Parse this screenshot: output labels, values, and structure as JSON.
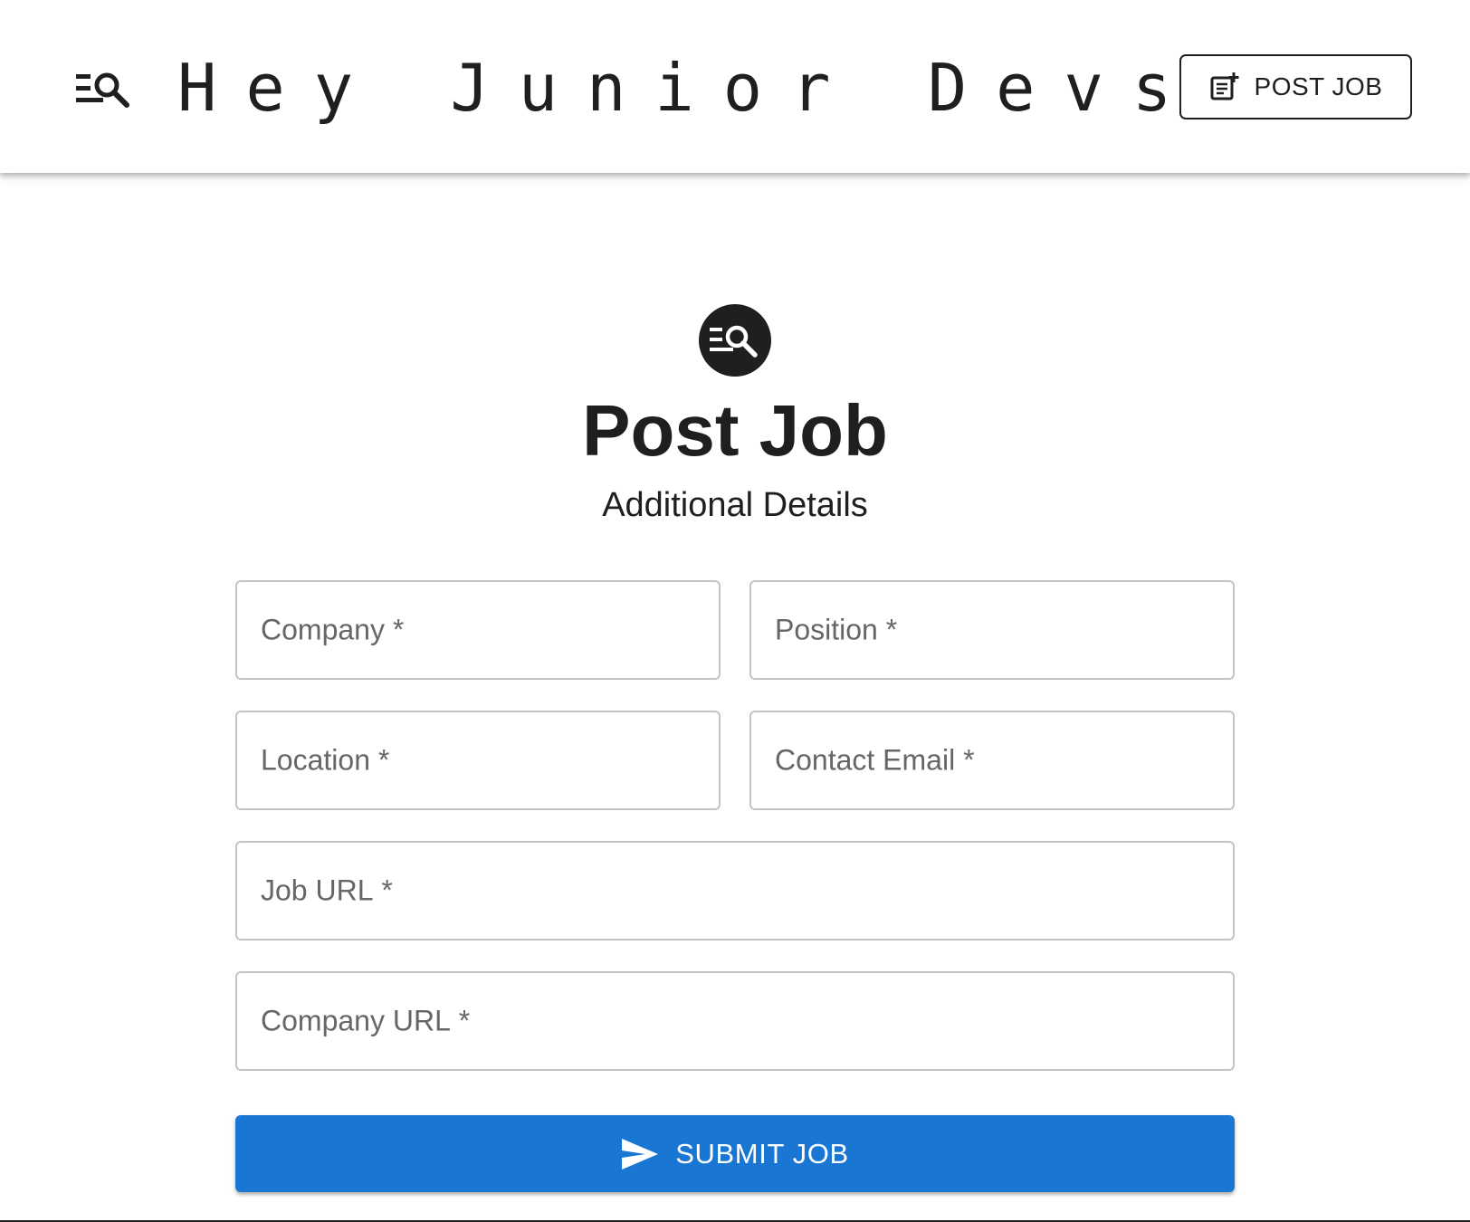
{
  "header": {
    "logo_icon": "manage-search-icon",
    "title": "Hey Junior Devs!",
    "post_job_label": "POST JOB",
    "post_job_icon": "post-add-icon"
  },
  "main": {
    "avatar_icon": "manage-search-icon",
    "title": "Post Job",
    "subtitle": "Additional Details"
  },
  "form": {
    "fields": [
      {
        "label": "Company",
        "required": "*",
        "value": ""
      },
      {
        "label": "Position",
        "required": "*",
        "value": ""
      },
      {
        "label": "Location",
        "required": "*",
        "value": ""
      },
      {
        "label": "Contact Email",
        "required": "*",
        "value": ""
      },
      {
        "label": "Job URL",
        "required": "*",
        "value": ""
      },
      {
        "label": "Company URL",
        "required": "*",
        "value": ""
      }
    ],
    "submit_label": "SUBMIT JOB",
    "submit_icon": "send-icon"
  },
  "colors": {
    "primary": "#1976d2",
    "text": "#1f1f1f",
    "label": "#666666",
    "border": "#c4c4c4"
  }
}
